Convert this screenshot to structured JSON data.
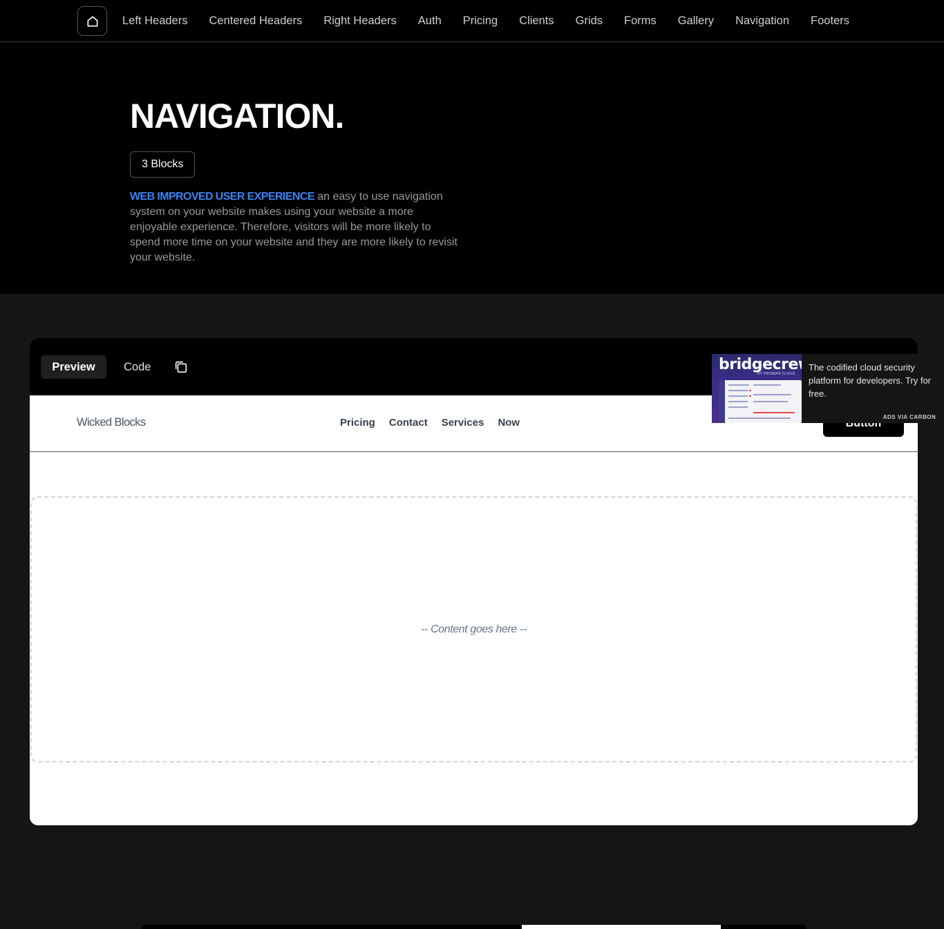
{
  "topnav": {
    "links": [
      "Left Headers",
      "Centered Headers",
      "Right Headers",
      "Auth",
      "Pricing",
      "Clients",
      "Grids",
      "Forms",
      "Gallery",
      "Navigation",
      "Footers"
    ]
  },
  "hero": {
    "title": "NAVIGATION.",
    "badge": "3 Blocks",
    "highlight": "WEB IMPROVED USER EXPERIENCE",
    "description": " an easy to use navigation system on your website makes using your website a more enjoyable experience. Therefore, visitors will be more likely to spend more time on your website and they are more likely to revisit your website."
  },
  "preview": {
    "tabs": {
      "preview": "Preview",
      "code": "Code"
    },
    "inner_nav": {
      "brand": "Wicked Blocks",
      "links": [
        "Pricing",
        "Contact",
        "Services",
        "Now"
      ],
      "button": "Button"
    },
    "content_placeholder": "-- Content goes here --"
  },
  "ad": {
    "logo": "bridgecrew",
    "logo_sub": "BY PRISMA® CLOUD",
    "text": "The codified cloud security platform for developers. Try for free.",
    "via": "ADS VIA CARBON"
  },
  "colors": {
    "accent": "#3b82f6",
    "background": "#151515",
    "header_bg": "#000000"
  }
}
